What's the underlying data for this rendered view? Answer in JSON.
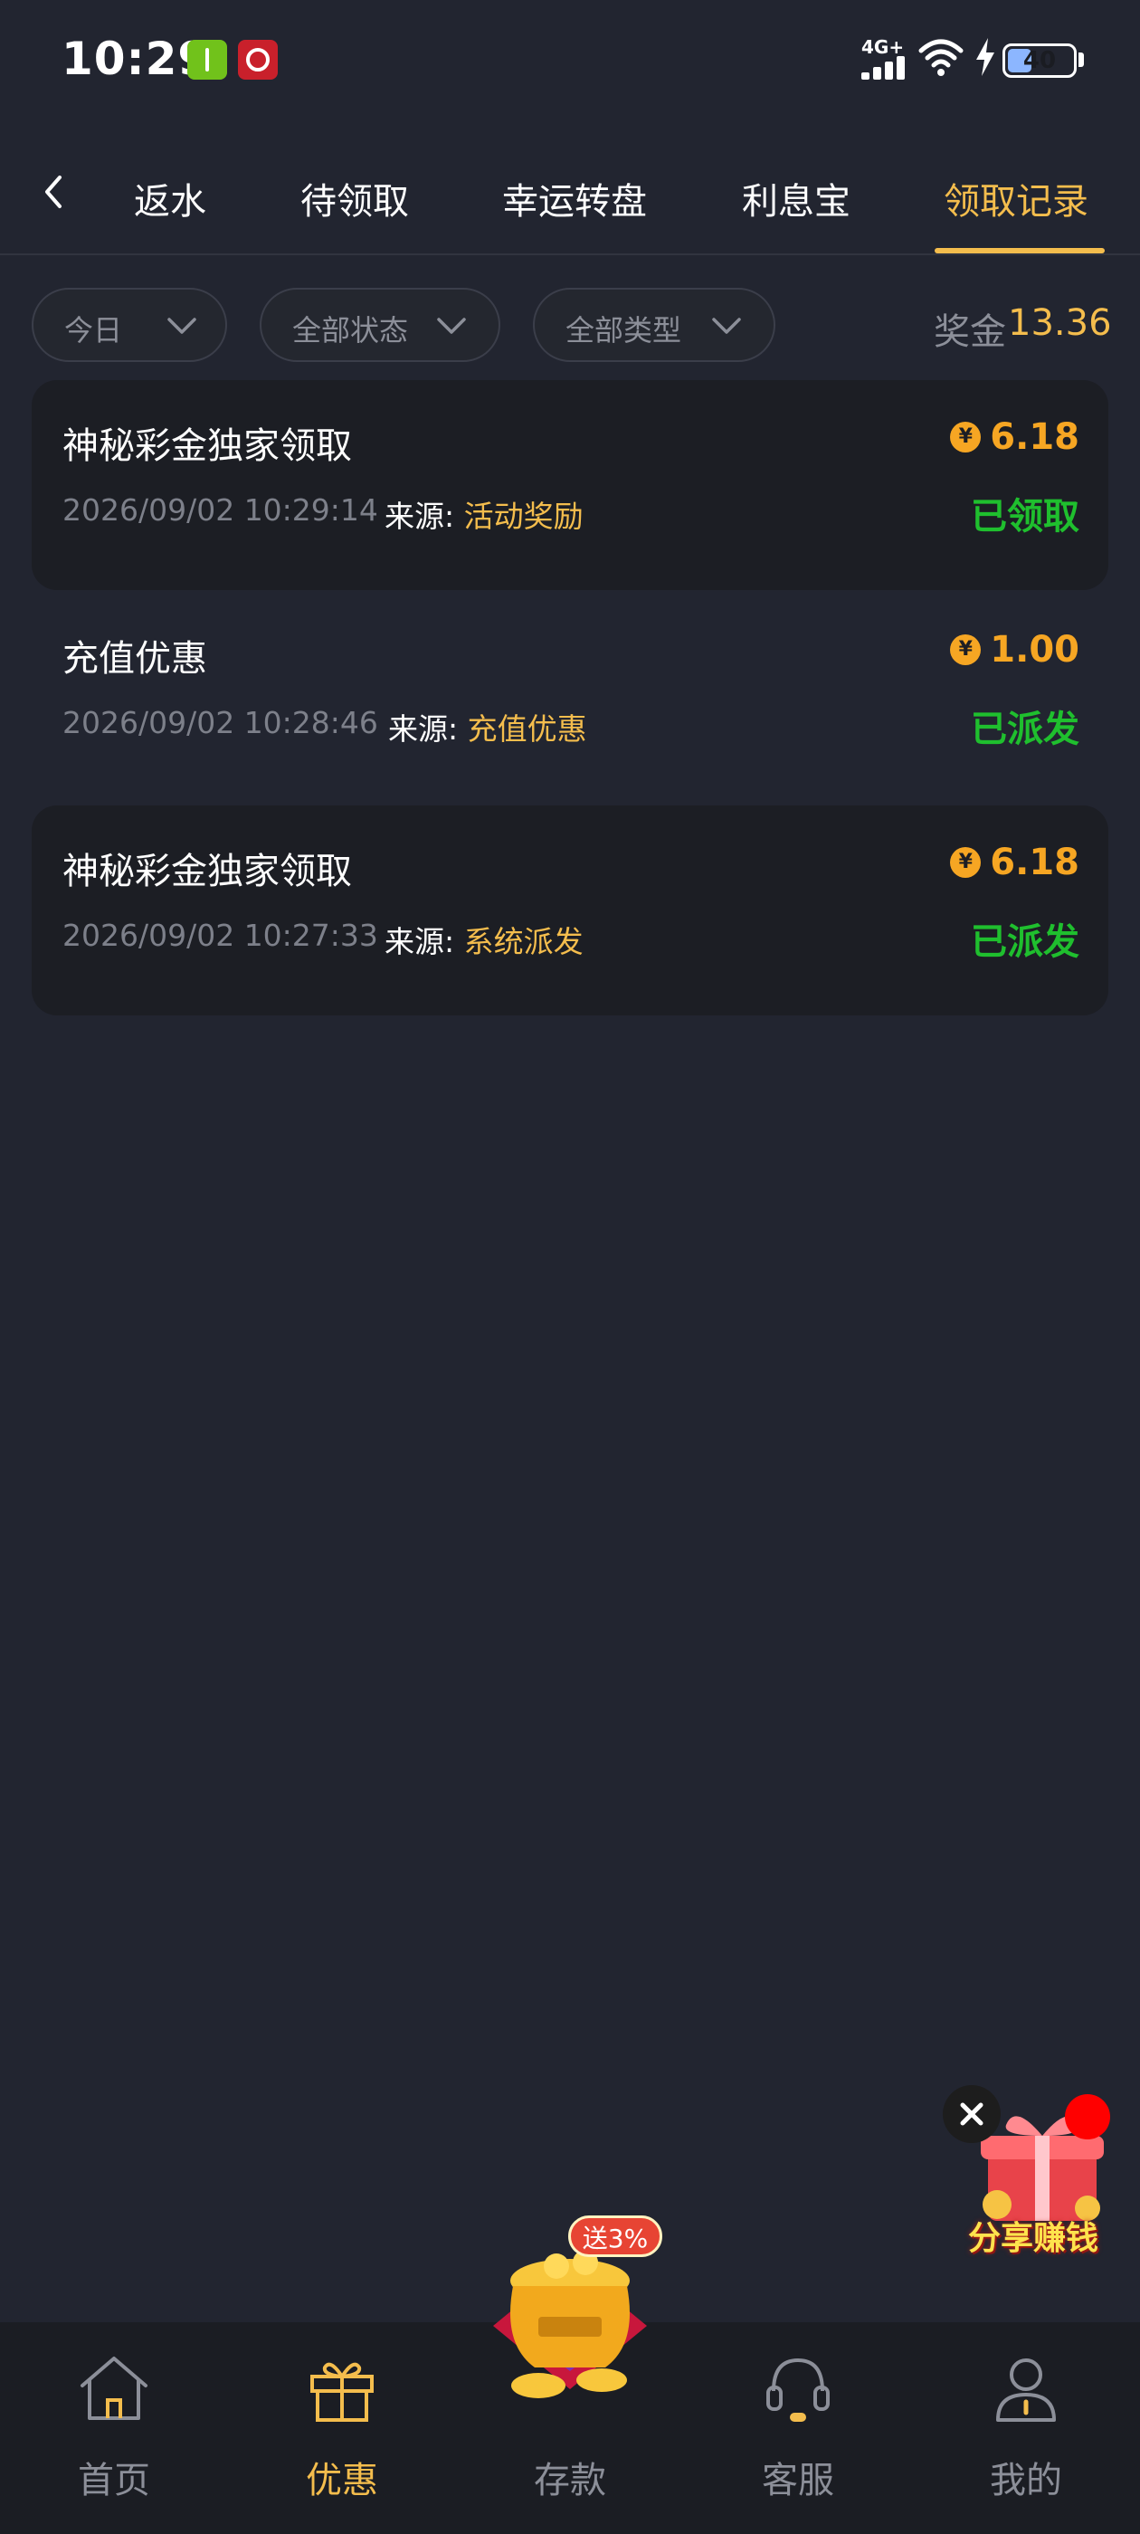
{
  "status_bar": {
    "time": "10:29",
    "network": "4G+",
    "battery": "40"
  },
  "tabs": [
    {
      "label": "返水"
    },
    {
      "label": "待领取"
    },
    {
      "label": "幸运转盘"
    },
    {
      "label": "利息宝"
    },
    {
      "label": "领取记录"
    }
  ],
  "active_tab": "领取记录",
  "filters": {
    "date": "今日",
    "status": "全部状态",
    "type": "全部类型"
  },
  "bonus": {
    "label": "奖金",
    "value": "13.36"
  },
  "coin_symbol": "¥",
  "records": [
    {
      "title": "神秘彩金独家领取",
      "time": "2026/09/02 10:29:14",
      "source_label": "来源:",
      "source": "活动奖励",
      "amount": "6.18",
      "status": "已领取"
    },
    {
      "title": "充值优惠",
      "time": "2026/09/02 10:28:46",
      "source_label": "来源:",
      "source": "充值优惠",
      "amount": "1.00",
      "status": "已派发"
    },
    {
      "title": "神秘彩金独家领取",
      "time": "2026/09/02 10:27:33",
      "source_label": "来源:",
      "source": "系统派发",
      "amount": "6.18",
      "status": "已派发"
    }
  ],
  "share_widget": {
    "label": "分享赚钱"
  },
  "deposit_badge": "送3%",
  "bottom_nav": [
    {
      "label": "首页",
      "icon": "home-icon"
    },
    {
      "label": "优惠",
      "icon": "gift-icon"
    },
    {
      "label": "存款",
      "icon": "gold-pot-icon"
    },
    {
      "label": "客服",
      "icon": "headset-icon"
    },
    {
      "label": "我的",
      "icon": "user-icon"
    }
  ],
  "colors": {
    "background": "#222530",
    "accent": "#f4bd4d",
    "amount": "#f6a623",
    "success": "#1fbf2e",
    "muted": "#8c8f99"
  }
}
